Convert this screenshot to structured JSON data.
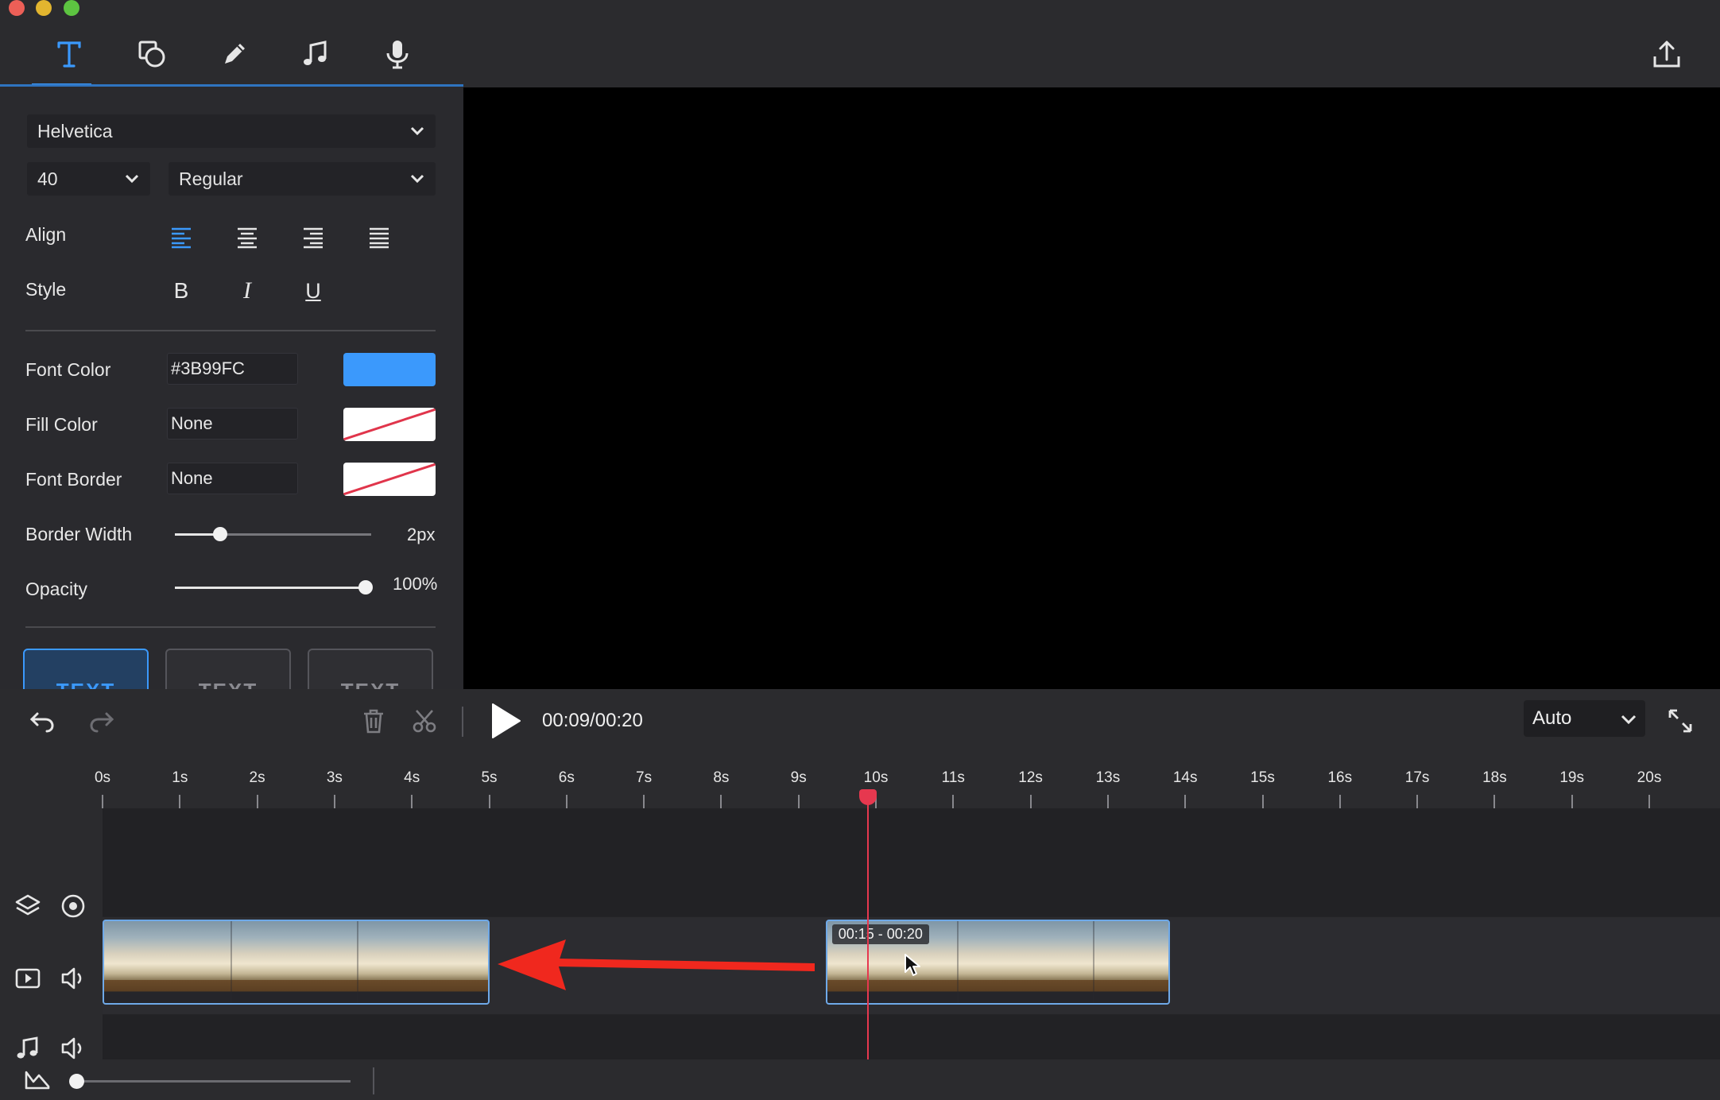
{
  "toolbar": {
    "tools": [
      {
        "name": "text-tool",
        "icon": "text-icon",
        "active": true
      },
      {
        "name": "shape-tool",
        "icon": "shapes-icon",
        "active": false
      },
      {
        "name": "draw-tool",
        "icon": "pencil-icon",
        "active": false
      },
      {
        "name": "music-tool",
        "icon": "music-note-icon",
        "active": false
      },
      {
        "name": "record-tool",
        "icon": "microphone-icon",
        "active": false
      }
    ],
    "export_icon": "export-icon",
    "accent": "#3B99FC"
  },
  "text_panel": {
    "font_family": "Helvetica",
    "font_size": "40",
    "font_weight": "Regular",
    "align_label": "Align",
    "align_options": [
      "left",
      "center",
      "right",
      "justify"
    ],
    "align_selected": "left",
    "style_label": "Style",
    "style_buttons": {
      "bold": "B",
      "italic": "I",
      "underline": "U"
    },
    "font_color_label": "Font Color",
    "font_color_value": "#3B99FC",
    "fill_color_label": "Fill Color",
    "fill_color_value": "None",
    "font_border_label": "Font Border",
    "font_border_value": "None",
    "border_width_label": "Border Width",
    "border_width_value": "2px",
    "border_width_level": 0.23,
    "opacity_label": "Opacity",
    "opacity_value": "100%",
    "opacity_level": 1.0,
    "presets": [
      "TEXT",
      "TEXT",
      "TEXT"
    ]
  },
  "timeline": {
    "timecode": "00:09/00:20",
    "zoom_mode": "Auto",
    "ruler_labels": [
      "0s",
      "1s",
      "2s",
      "3s",
      "4s",
      "5s",
      "6s",
      "7s",
      "8s",
      "9s",
      "10s",
      "11s",
      "12s",
      "13s",
      "14s",
      "15s",
      "16s",
      "17s",
      "18s",
      "19s",
      "20s"
    ],
    "playhead_seconds": 9.9,
    "clips": [
      {
        "start": 0,
        "end": 5
      },
      {
        "start": 9.35,
        "end": 13.8,
        "badge": "00:15 - 00:20"
      }
    ],
    "zoom_level": 0
  },
  "colors": {
    "playhead": "#E6384F",
    "arrow": "#F0281E",
    "swatch_none_slash": "#E0354B"
  }
}
